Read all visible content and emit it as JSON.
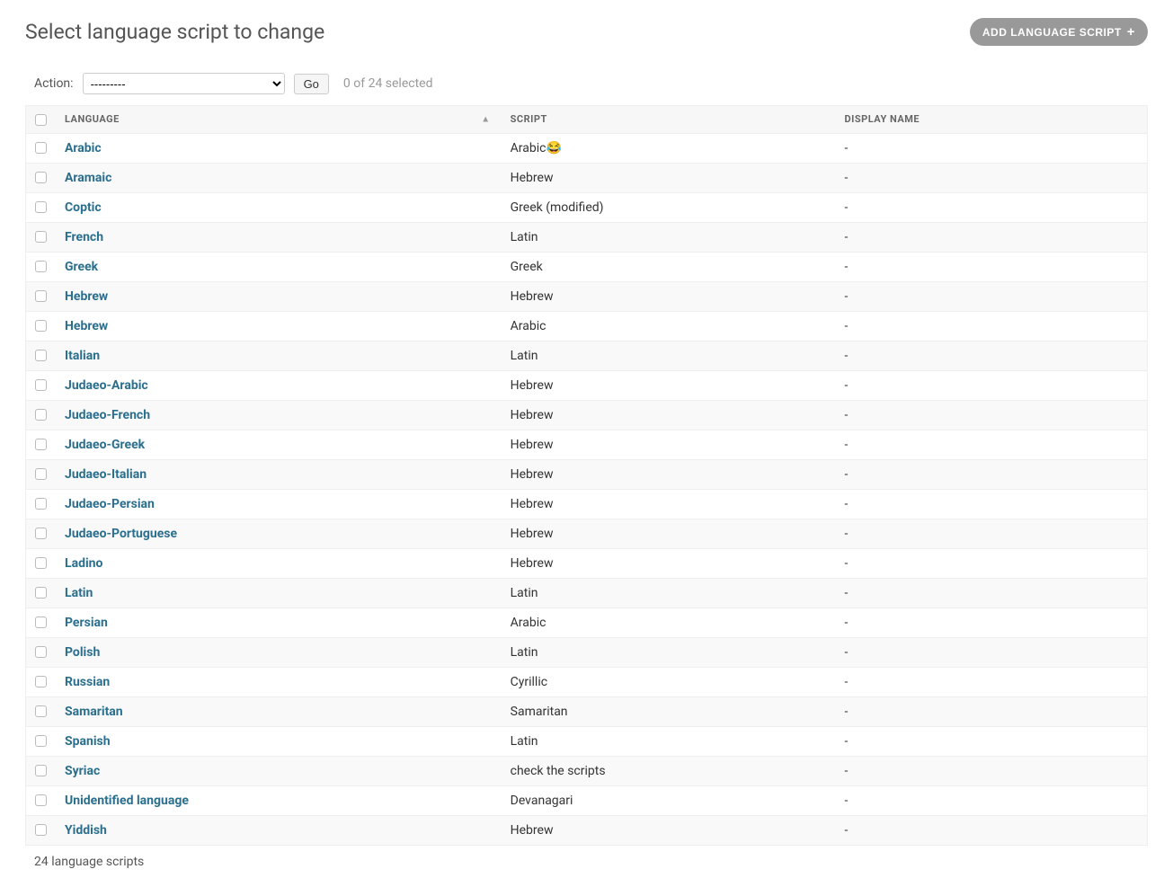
{
  "header": {
    "title": "Select language script to change",
    "add_button": "ADD LANGUAGE SCRIPT"
  },
  "actions": {
    "label": "Action:",
    "placeholder": "---------",
    "go": "Go",
    "selected_text": "0 of 24 selected"
  },
  "columns": {
    "language": "Language",
    "script": "Script",
    "display_name": "Display Name"
  },
  "rows": [
    {
      "language": "Arabic",
      "script": "Arabic😂",
      "display_name": "-"
    },
    {
      "language": "Aramaic",
      "script": "Hebrew",
      "display_name": "-"
    },
    {
      "language": "Coptic",
      "script": "Greek (modified)",
      "display_name": "-"
    },
    {
      "language": "French",
      "script": "Latin",
      "display_name": "-"
    },
    {
      "language": "Greek",
      "script": "Greek",
      "display_name": "-"
    },
    {
      "language": "Hebrew",
      "script": "Hebrew",
      "display_name": "-"
    },
    {
      "language": "Hebrew",
      "script": "Arabic",
      "display_name": "-"
    },
    {
      "language": "Italian",
      "script": "Latin",
      "display_name": "-"
    },
    {
      "language": "Judaeo-Arabic",
      "script": "Hebrew",
      "display_name": "-"
    },
    {
      "language": "Judaeo-French",
      "script": "Hebrew",
      "display_name": "-"
    },
    {
      "language": "Judaeo-Greek",
      "script": "Hebrew",
      "display_name": "-"
    },
    {
      "language": "Judaeo-Italian",
      "script": "Hebrew",
      "display_name": "-"
    },
    {
      "language": "Judaeo-Persian",
      "script": "Hebrew",
      "display_name": "-"
    },
    {
      "language": "Judaeo-Portuguese",
      "script": "Hebrew",
      "display_name": "-"
    },
    {
      "language": "Ladino",
      "script": "Hebrew",
      "display_name": "-"
    },
    {
      "language": "Latin",
      "script": "Latin",
      "display_name": "-"
    },
    {
      "language": "Persian",
      "script": "Arabic",
      "display_name": "-"
    },
    {
      "language": "Polish",
      "script": "Latin",
      "display_name": "-"
    },
    {
      "language": "Russian",
      "script": "Cyrillic",
      "display_name": "-"
    },
    {
      "language": "Samaritan",
      "script": "Samaritan",
      "display_name": "-"
    },
    {
      "language": "Spanish",
      "script": "Latin",
      "display_name": "-"
    },
    {
      "language": "Syriac",
      "script": "check the scripts",
      "display_name": "-"
    },
    {
      "language": "Unidentified language",
      "script": "Devanagari",
      "display_name": "-"
    },
    {
      "language": "Yiddish",
      "script": "Hebrew",
      "display_name": "-"
    }
  ],
  "footer": {
    "count_text": "24 language scripts"
  }
}
